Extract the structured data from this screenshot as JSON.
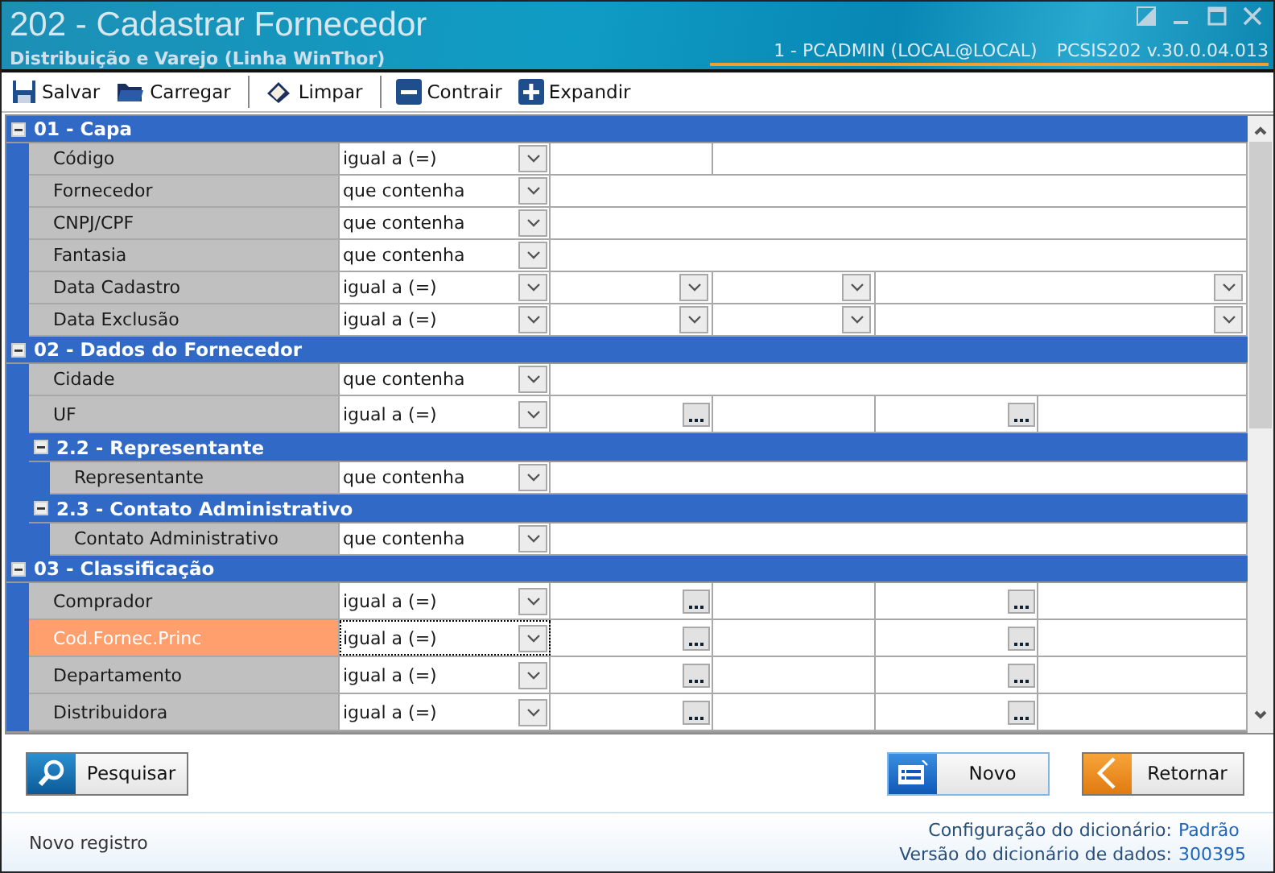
{
  "window": {
    "title": "202 - Cadastrar  Fornecedor",
    "subtitle": "Distribuição e Varejo (Linha WinThor)",
    "user": "1 - PCADMIN (LOCAL@LOCAL)",
    "version": "PCSIS202  v.30.0.04.013"
  },
  "toolbar": [
    [
      {
        "kind": "save",
        "label": "Salvar"
      },
      {
        "kind": "open",
        "label": "Carregar"
      }
    ],
    [
      {
        "kind": "clear",
        "label": "Limpar"
      }
    ],
    [
      {
        "kind": "collapse",
        "label": "Contrair"
      },
      {
        "kind": "expand",
        "label": "Expandir"
      }
    ]
  ],
  "sections": [
    {
      "title": "01 - Capa",
      "expanded": true,
      "rows": [
        {
          "label": "Código",
          "operator": "igual a (=)",
          "kind": "code",
          "selected": false
        },
        {
          "label": "Fornecedor",
          "operator": "que contenha",
          "kind": "text",
          "selected": false
        },
        {
          "label": "CNPJ/CPF",
          "operator": "que contenha",
          "kind": "text",
          "selected": false
        },
        {
          "label": "Fantasia",
          "operator": "que contenha",
          "kind": "text",
          "selected": false
        },
        {
          "label": "Data Cadastro",
          "operator": "igual a (=)",
          "kind": "range_select",
          "selected": false
        },
        {
          "label": "Data Exclusão",
          "operator": "igual a (=)",
          "kind": "range_select",
          "selected": false
        }
      ]
    },
    {
      "title": "02 - Dados do Fornecedor",
      "expanded": true,
      "rows": [
        {
          "label": "Cidade",
          "operator": "que contenha",
          "kind": "text",
          "selected": false
        },
        {
          "label": "UF",
          "operator": "igual a (=)",
          "kind": "lookup",
          "selected": false
        }
      ],
      "children": [
        {
          "title": "2.2 - Representante",
          "expanded": true,
          "rows": [
            {
              "label": "Representante",
              "operator": "que contenha",
              "kind": "text",
              "selected": false
            }
          ]
        },
        {
          "title": "2.3 - Contato Administrativo",
          "expanded": true,
          "rows": [
            {
              "label": "Contato Administrativo",
              "operator": "que contenha",
              "kind": "text",
              "selected": false
            }
          ]
        }
      ]
    },
    {
      "title": "03 - Classificação",
      "expanded": true,
      "rows": [
        {
          "label": "Comprador",
          "operator": "igual a (=)",
          "kind": "lookup",
          "selected": false
        },
        {
          "label": "Cod.Fornec.Princ",
          "operator": "igual a (=)",
          "kind": "lookup",
          "selected": true
        },
        {
          "label": "Departamento",
          "operator": "igual a (=)",
          "kind": "lookup",
          "selected": false
        },
        {
          "label": "Distribuidora",
          "operator": "igual a (=)",
          "kind": "lookup",
          "selected": false
        }
      ]
    }
  ],
  "actions": [
    {
      "kind": "search",
      "label": "Pesquisar",
      "focused": false
    },
    {
      "kind": "new",
      "label": "Novo",
      "focused": true
    },
    {
      "kind": "back",
      "label": "Retornar",
      "focused": false
    }
  ],
  "status_bar": {
    "message": "Novo registro",
    "info": [
      {
        "label": "Configuração do dicionário:",
        "value": "Padrão"
      },
      {
        "label": "Versão do dicionário de dados:",
        "value": "300395"
      }
    ]
  }
}
